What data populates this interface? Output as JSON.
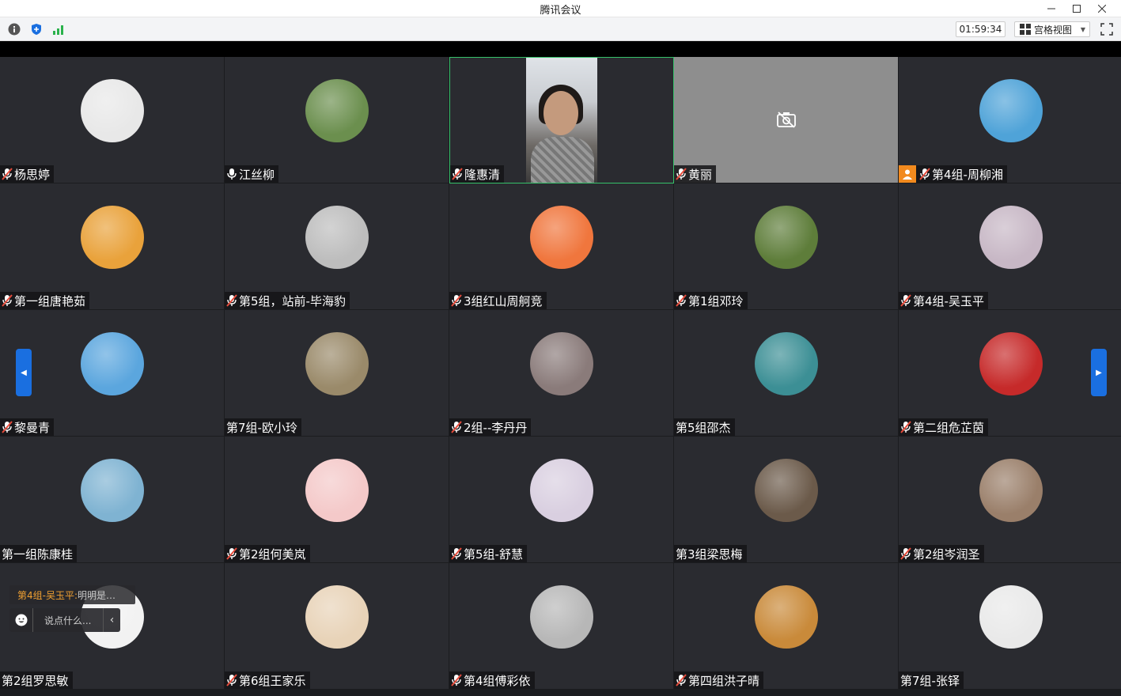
{
  "window": {
    "title": "腾讯会议"
  },
  "toolbar": {
    "timer": "01:59:34",
    "view_label": "宫格视图",
    "icons": [
      "info-icon",
      "shield-icon",
      "signal-icon",
      "grid-view-icon",
      "fullscreen-icon"
    ]
  },
  "colors": {
    "accent": "#1a6fe0",
    "active_speaker": "#36c16a",
    "host_badge": "#f28a1e",
    "chat_name": "#f0a032"
  },
  "participants": [
    {
      "name": "杨思婷",
      "muted": true,
      "avatar": "#e8e8e8"
    },
    {
      "name": "江丝柳",
      "muted": false,
      "avatar": "#6b8f4e"
    },
    {
      "name": "隆惠清",
      "muted": true,
      "video": true
    },
    {
      "name": "黄丽",
      "muted": true,
      "camera_off": true
    },
    {
      "name": "第4组-周柳湘",
      "muted": true,
      "host": true,
      "avatar": "#4fa3d8"
    },
    {
      "name": "第一组唐艳茹",
      "muted": true,
      "avatar": "#e9a23b"
    },
    {
      "name": "第5组，站前-毕海豹",
      "muted": true,
      "avatar": "#bdbdbd"
    },
    {
      "name": "3组红山周舸竞",
      "muted": true,
      "avatar": "#f0763d"
    },
    {
      "name": "第1组邓玲",
      "muted": true,
      "avatar": "#5e7d3a"
    },
    {
      "name": "第4组-吴玉平",
      "muted": true,
      "avatar": "#c7b7c5"
    },
    {
      "name": "黎曼青",
      "muted": true,
      "avatar": "#5ba6de"
    },
    {
      "name": "第7组-欧小玲",
      "muted": false,
      "avatar": "#9a8a6a"
    },
    {
      "name": "2组--李丹丹",
      "muted": true,
      "avatar": "#8a7b7a"
    },
    {
      "name": "第5组邵杰",
      "muted": false,
      "avatar": "#3c8f95"
    },
    {
      "name": "第二组危芷茵",
      "muted": true,
      "avatar": "#c62a2a"
    },
    {
      "name": "第一组陈康桂",
      "muted": false,
      "avatar": "#7fb3d2"
    },
    {
      "name": "第2组何美岚",
      "muted": true,
      "avatar": "#f4c9c9"
    },
    {
      "name": "第5组-舒慧",
      "muted": true,
      "avatar": "#d9cfe0"
    },
    {
      "name": "第3组梁思梅",
      "muted": false,
      "avatar": "#6b5a4a"
    },
    {
      "name": "第2组岑润圣",
      "muted": true,
      "avatar": "#9a7f6a"
    },
    {
      "name": "第2组罗思敏",
      "muted": false,
      "avatar": "#f2f2f2"
    },
    {
      "name": "第6组王家乐",
      "muted": true,
      "avatar": "#e8d3b8"
    },
    {
      "name": "第4组傅彩依",
      "muted": true,
      "avatar": "#b7b7b7"
    },
    {
      "name": "第四组洪子晴",
      "muted": true,
      "avatar": "#c98a3a"
    },
    {
      "name": "第7组-张铎",
      "muted": false,
      "avatar": "#e9e9e9"
    }
  ],
  "chat": {
    "toast_name": "第4组-吴玉平:",
    "toast_message": "明明是…",
    "input_placeholder": "说点什么..."
  }
}
